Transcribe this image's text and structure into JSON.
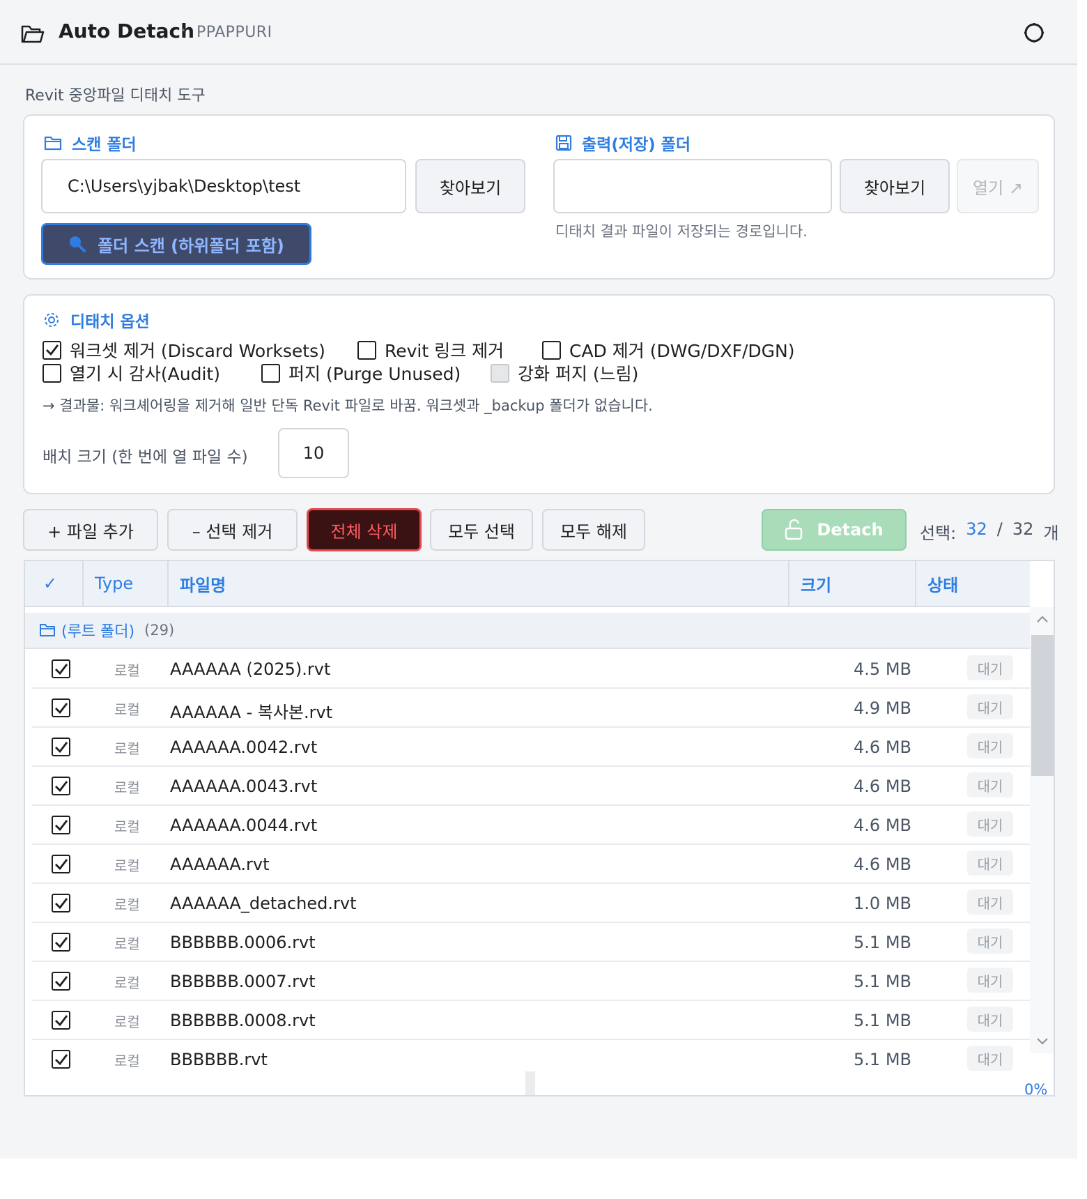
{
  "app": {
    "title": "Auto Detach",
    "separator": "·",
    "subtitle": "PPAPPURI",
    "description": "Revit 중앙파일 디태치 도구",
    "icons": {
      "app": "folder-open-icon",
      "theme": "theme-toggle-icon"
    }
  },
  "scan": {
    "title": "스캔 폴더",
    "path": "C:\\Users\\yjbak\\Desktop\\test",
    "browse_label": "찾아보기",
    "scan_button": "폴더 스캔 (하위폴더 포함)"
  },
  "output": {
    "title": "출력(저장) 폴더",
    "path": "",
    "browse_label": "찾아보기",
    "open_label": "열기 ↗",
    "hint": "디태치 결과 파일이 저장되는 경로입니다."
  },
  "options": {
    "title": "디태치 옵션",
    "items": [
      {
        "label": "워크셋 제거 (Discard Worksets)",
        "checked": true,
        "disabled": false
      },
      {
        "label": "Revit 링크 제거",
        "checked": false,
        "disabled": false
      },
      {
        "label": "CAD 제거 (DWG/DXF/DGN)",
        "checked": false,
        "disabled": false
      },
      {
        "label": "열기 시 감사(Audit)",
        "checked": false,
        "disabled": false
      },
      {
        "label": "퍼지 (Purge Unused)",
        "checked": false,
        "disabled": false
      },
      {
        "label": "강화 퍼지 (느림)",
        "checked": false,
        "disabled": true
      }
    ],
    "result_note": "→ 결과물: 워크셰어링을 제거해 일반 단독 Revit 파일로 바꿈. 워크셋과 _backup 폴더가 없습니다.",
    "batch_label": "배치 크기 (한 번에 열 파일 수)",
    "batch_value": "10"
  },
  "toolbar": {
    "add_files": "+ 파일 추가",
    "remove_selected": "– 선택 제거",
    "delete_all": "전체 삭제",
    "select_all": "모두 선택",
    "deselect_all": "모두 해제",
    "detach": "Detach",
    "selection_label": "선택:",
    "selected_count": "32",
    "slash": "/",
    "total_count": "32",
    "unit": "개"
  },
  "table": {
    "headers": {
      "check": "✓",
      "type": "Type",
      "name": "파일명",
      "size": "크기",
      "status": "상태"
    },
    "group": {
      "name": "(루트 폴더)",
      "count": "(29)"
    },
    "rows": [
      {
        "checked": true,
        "type": "로컬",
        "name": "AAAAAA (2025).rvt",
        "size": "4.5 MB",
        "status": "대기"
      },
      {
        "checked": true,
        "type": "로컬",
        "name": "AAAAAA - 복사본.rvt",
        "size": "4.9 MB",
        "status": "대기"
      },
      {
        "checked": true,
        "type": "로컬",
        "name": "AAAAAA.0042.rvt",
        "size": "4.6 MB",
        "status": "대기"
      },
      {
        "checked": true,
        "type": "로컬",
        "name": "AAAAAA.0043.rvt",
        "size": "4.6 MB",
        "status": "대기"
      },
      {
        "checked": true,
        "type": "로컬",
        "name": "AAAAAA.0044.rvt",
        "size": "4.6 MB",
        "status": "대기"
      },
      {
        "checked": true,
        "type": "로컬",
        "name": "AAAAAA.rvt",
        "size": "4.6 MB",
        "status": "대기"
      },
      {
        "checked": true,
        "type": "로컬",
        "name": "AAAAAA_detached.rvt",
        "size": "1.0 MB",
        "status": "대기"
      },
      {
        "checked": true,
        "type": "로컬",
        "name": "BBBBBB.0006.rvt",
        "size": "5.1 MB",
        "status": "대기"
      },
      {
        "checked": true,
        "type": "로컬",
        "name": "BBBBBB.0007.rvt",
        "size": "5.1 MB",
        "status": "대기"
      },
      {
        "checked": true,
        "type": "로컬",
        "name": "BBBBBB.0008.rvt",
        "size": "5.1 MB",
        "status": "대기"
      },
      {
        "checked": true,
        "type": "로컬",
        "name": "BBBBBB.rvt",
        "size": "5.1 MB",
        "status": "대기"
      }
    ]
  },
  "progress": {
    "percent_label": "0%",
    "value": 0
  },
  "colors": {
    "accent": "#2f7de1",
    "danger": "#e5484d",
    "detach_disabled": "#a9dcb9"
  }
}
